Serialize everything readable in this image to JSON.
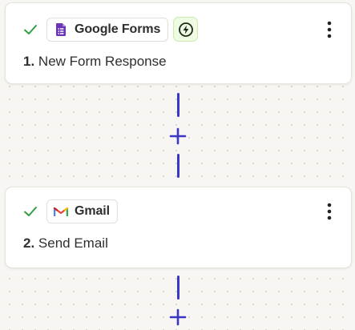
{
  "steps": [
    {
      "status_icon": "check-icon",
      "app_name": "Google Forms",
      "app_icon": "google-forms-icon",
      "trigger_icon": "instant-trigger-bolt-icon",
      "number": "1.",
      "title": "New Form Response"
    },
    {
      "status_icon": "check-icon",
      "app_name": "Gmail",
      "app_icon": "gmail-icon",
      "number": "2.",
      "title": "Send Email"
    }
  ],
  "add_step_icon": "plus-icon",
  "menu_icon": "more-vertical-icon",
  "colors": {
    "check": "#2f9e44",
    "connector": "#3d36c4",
    "forms_purple": "#6b35b6",
    "bolt_bg": "#effbe2",
    "canvas_bg": "#f7f6f3"
  }
}
